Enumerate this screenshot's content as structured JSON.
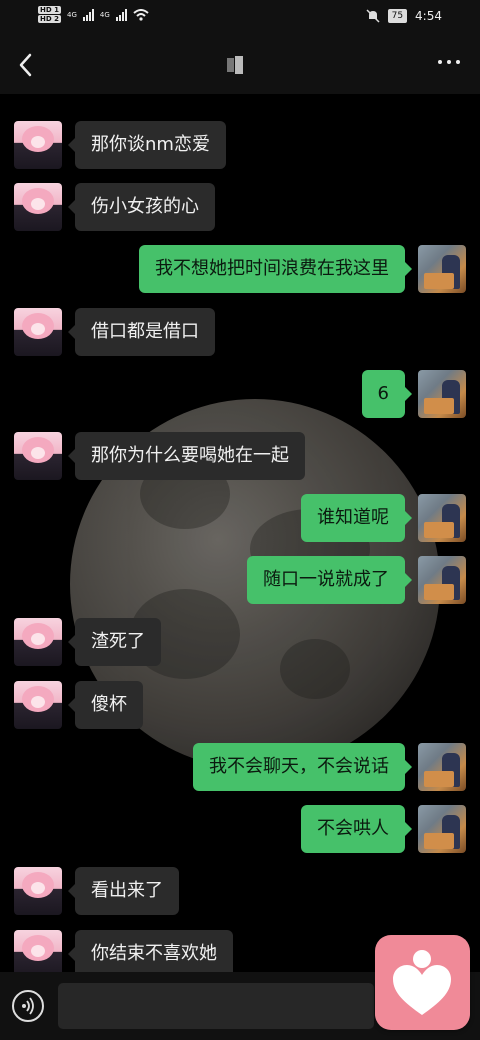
{
  "status_bar": {
    "hd1": "HD 1",
    "hd2": "HD 2",
    "network1": "4G",
    "network2": "4G",
    "battery": "75",
    "time": "4:54"
  },
  "header": {
    "title_icon": "chat-title-icon",
    "more_icon": "more-icon"
  },
  "messages": [
    {
      "side": "left",
      "text": "那你谈nm恋爱"
    },
    {
      "side": "left",
      "text": "伤小女孩的心"
    },
    {
      "side": "right",
      "text": "我不想她把时间浪费在我这里"
    },
    {
      "side": "left",
      "text": "借口都是借口"
    },
    {
      "side": "right",
      "text": "6"
    },
    {
      "side": "left",
      "text": "那你为什么要喝她在一起"
    },
    {
      "side": "right",
      "text": "谁知道呢"
    },
    {
      "side": "right",
      "text": "随口一说就成了"
    },
    {
      "side": "left",
      "text": "渣死了"
    },
    {
      "side": "left",
      "text": "傻杯"
    },
    {
      "side": "right",
      "text": "我不会聊天，不会说话"
    },
    {
      "side": "right",
      "text": "不会哄人"
    },
    {
      "side": "left",
      "text": "看出来了"
    },
    {
      "side": "left",
      "text": "你结束不喜欢她"
    }
  ],
  "input": {
    "value": "",
    "placeholder": ""
  },
  "colors": {
    "outgoing_bubble": "#46c16a",
    "incoming_bubble": "#2b2b2b",
    "floating_button": "#f08a98"
  }
}
